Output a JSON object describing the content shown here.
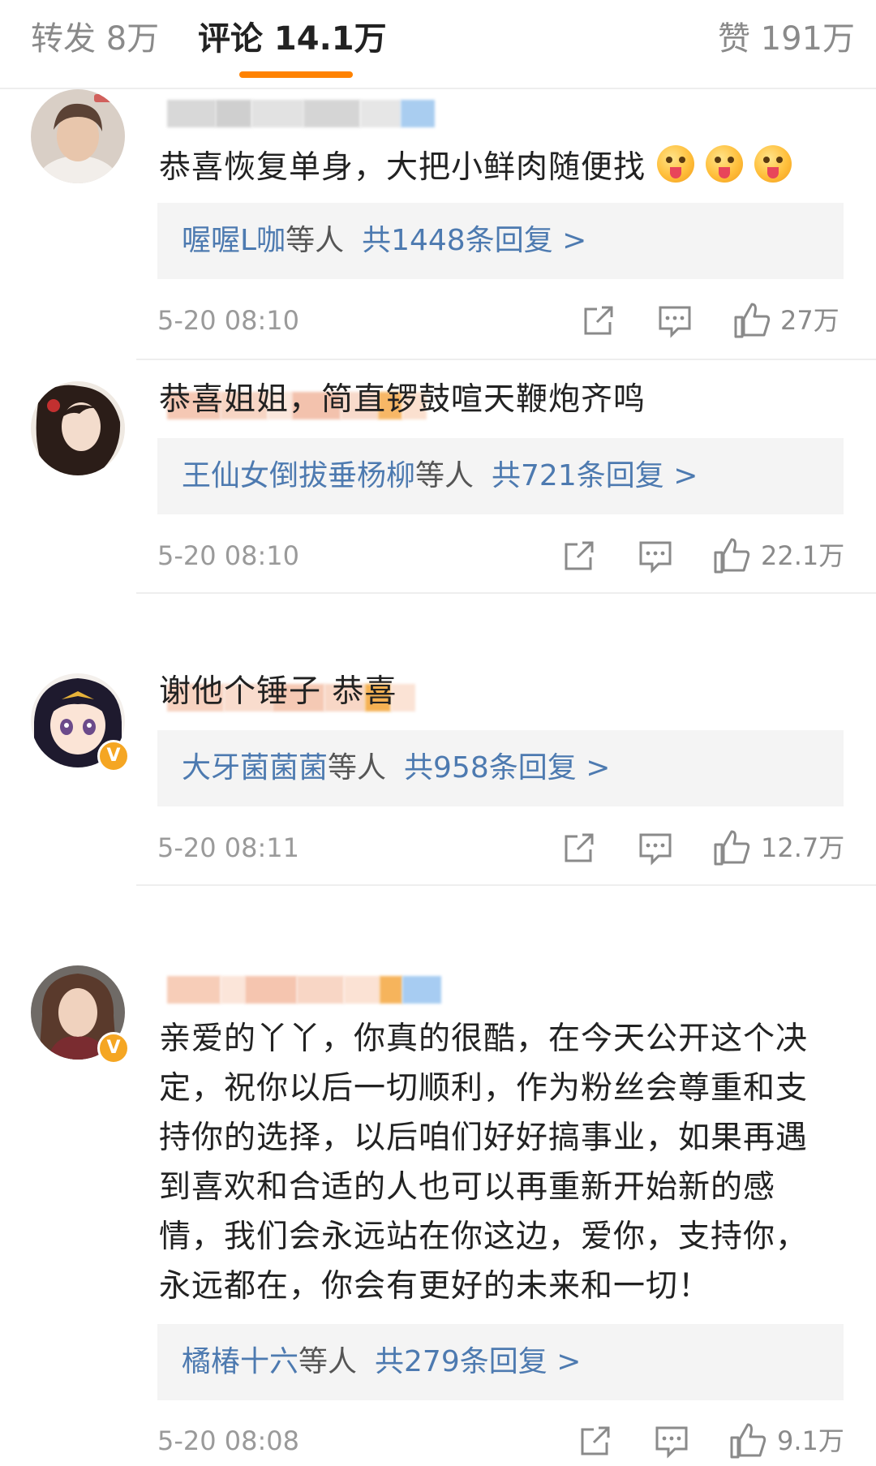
{
  "tabs": {
    "repost": "转发 8万",
    "comment": "评论 14.1万",
    "like": "赞 191万"
  },
  "colors": {
    "accent": "#ff8200",
    "link": "#4d7ab0",
    "verified_badge": "#f5a623",
    "reply_bg": "#f4f4f4"
  },
  "icons": {
    "repost": "share-box-icon",
    "comment": "chat-bubble-icon",
    "like": "thumb-up-icon",
    "verified": "v-badge-icon"
  },
  "comments": [
    {
      "text": "恭喜恢复单身，大把小鲜肉随便找",
      "emoji_count": 3,
      "verified": false,
      "reply_who": "喔喔L咖",
      "reply_suffix": "等人",
      "reply_count": "共1448条回复 >",
      "time": "5-20 08:10",
      "likes": "27万"
    },
    {
      "text": "恭喜姐姐，简直锣鼓喧天鞭炮齐鸣",
      "emoji_count": 0,
      "verified": false,
      "reply_who": "王仙女倒拔垂杨柳",
      "reply_suffix": "等人",
      "reply_count": "共721条回复 >",
      "time": "5-20 08:10",
      "likes": "22.1万"
    },
    {
      "text": "谢他个锤子 恭喜",
      "emoji_count": 0,
      "verified": true,
      "verified_glyph": "V",
      "reply_who": "大牙菌菌菌",
      "reply_suffix": "等人",
      "reply_count": "共958条回复 >",
      "time": "5-20 08:11",
      "likes": "12.7万"
    },
    {
      "text_lines": [
        "亲爱的丫丫，你真的很酷，在今天公开这个决",
        "定，祝你以后一切顺利，作为粉丝会尊重和支",
        "持你的选择，以后咱们好好搞事业，如果再遇",
        "到喜欢和合适的人也可以再重新开始新的感",
        "情，我们会永远站在你这边，爱你，支持你，",
        "永远都在，你会有更好的未来和一切！"
      ],
      "verified": true,
      "verified_glyph": "V",
      "reply_who": "橘椿十六",
      "reply_suffix": "等人",
      "reply_count": "共279条回复 >",
      "time": "5-20 08:08",
      "likes": "9.1万"
    }
  ]
}
